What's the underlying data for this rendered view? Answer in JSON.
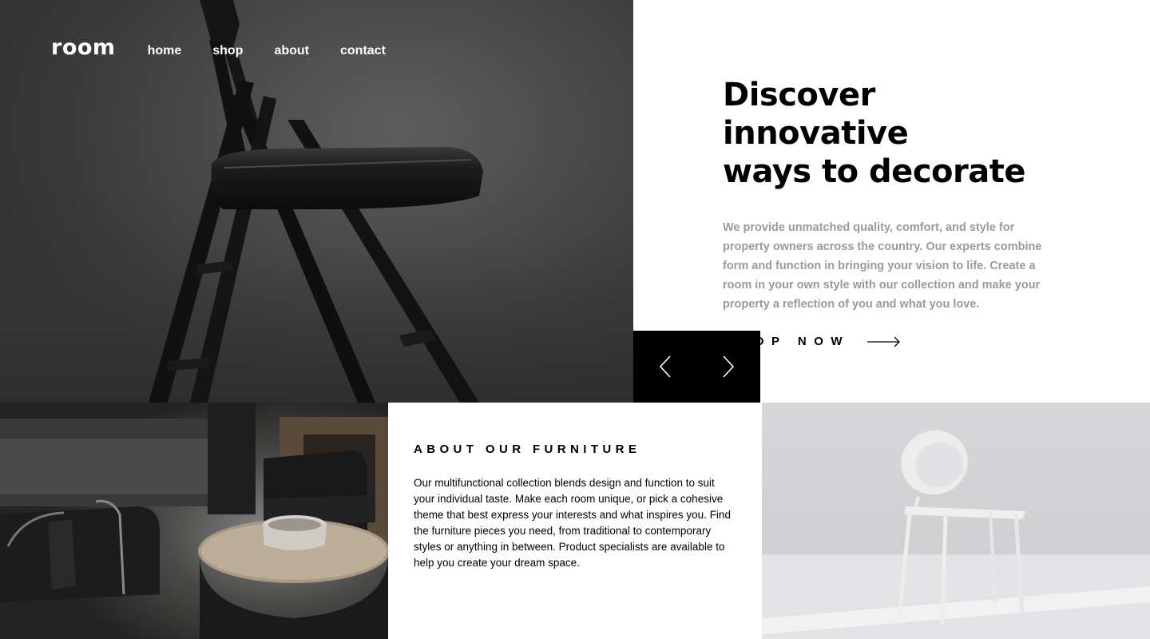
{
  "header": {
    "logo": "room",
    "nav": [
      "home",
      "shop",
      "about",
      "contact"
    ]
  },
  "hero": {
    "title_line1": "Discover innovative",
    "title_line2": "ways to decorate",
    "description": "We provide unmatched quality, comfort, and style for property owners across the country. Our experts combine form and function in bringing your vision to life. Create a room in your own style with our collection and make your property a reflection of you and what you love.",
    "cta_label": "SHOP NOW",
    "cta_icon": "arrow-right-icon",
    "image_icon": "folding-chair-image"
  },
  "slider": {
    "prev_icon": "chevron-left-icon",
    "next_icon": "chevron-right-icon"
  },
  "about": {
    "title": "ABOUT OUR FURNITURE",
    "description": "Our multifunctional collection blends design and function to suit your individual taste. Make each room unique, or pick a cohesive theme that best express your interests and what inspires you. Find the furniture pieces you need, from traditional to contemporary styles or anything in between. Product specialists are available to help you create your dream space.",
    "dark_image": "living-room-dark-image",
    "light_image": "white-chair-image"
  },
  "colors": {
    "text_primary": "#000000",
    "text_muted": "#9a9a9a",
    "background": "#ffffff",
    "control_bg": "#000000"
  }
}
